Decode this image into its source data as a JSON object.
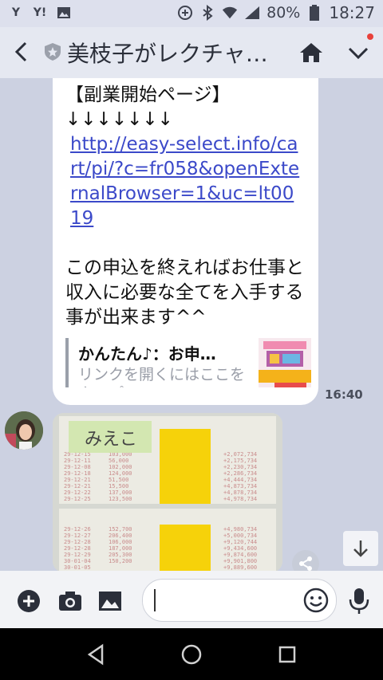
{
  "status_bar": {
    "left_icons": [
      "yahoo-japan-icon",
      "yahoo-icon",
      "image-icon"
    ],
    "left_labels": [
      "Y",
      "Y!"
    ],
    "battery": "80%",
    "time": "18:27",
    "right_icons": [
      "data-saver-icon",
      "bluetooth-icon",
      "wifi-icon",
      "signal-icon",
      "battery-icon"
    ]
  },
  "header": {
    "title": "美枝子がレクチャ…",
    "back_icon": "chevron-left-icon",
    "official_icon": "shield-star-icon",
    "home_icon": "home-icon",
    "menu_icon": "chevron-down-icon",
    "notification_dot_color": "#e8413b"
  },
  "message": {
    "heading": "【副業開始ページ】",
    "arrows": "↓↓↓↓↓↓↓",
    "link": "http://easy-select.info/cart/pi/?c=fr058&openExternalBrowser=1&uc=lt0019",
    "body": "この申込を終えればお仕事と収入に必要な全てを入手する事が出来ます^^",
    "preview_title": "かんたん♪：お申…",
    "preview_desc": "リンクを開くにはここをタップ",
    "time": "16:40"
  },
  "image_message": {
    "note_label": "みえこ",
    "dates": [
      "29-12-15",
      "29-12-11",
      "29-12-08",
      "29-12-18",
      "29-12-21",
      "29-12-21",
      "29-12-22",
      "29-12-25",
      "29-12-26",
      "29-12-27",
      "29-12-28",
      "29-12-28",
      "29-12-29",
      "30-01-04",
      "30-01-05"
    ],
    "amounts": [
      "103,000",
      "56,000",
      "102,000",
      "124,000",
      "51,500",
      "15,500",
      "137,000",
      "123,500",
      "152,700",
      "206,400",
      "106,000",
      "187,000",
      "205,300",
      "150,200"
    ],
    "balances": [
      "+2,072,734",
      "+2,175,734",
      "+2,230,734",
      "+2,286,734",
      "+4,444,734",
      "+4,873,734",
      "+4,878,734",
      "+4,978,734",
      "+4,980,734",
      "+5,000,734",
      "+9,120,744",
      "+9,434,600",
      "+9,874,600",
      "+9,901,800",
      "+9,889,600"
    ],
    "highlight_color": "#f6d20a"
  },
  "input_bar": {
    "icons": [
      "plus-icon",
      "camera-icon",
      "gallery-icon",
      "emoji-icon",
      "microphone-icon"
    ],
    "text_value": ""
  },
  "nav_bar": {
    "icons": [
      "back-triangle-icon",
      "home-circle-icon",
      "recents-square-icon"
    ]
  }
}
